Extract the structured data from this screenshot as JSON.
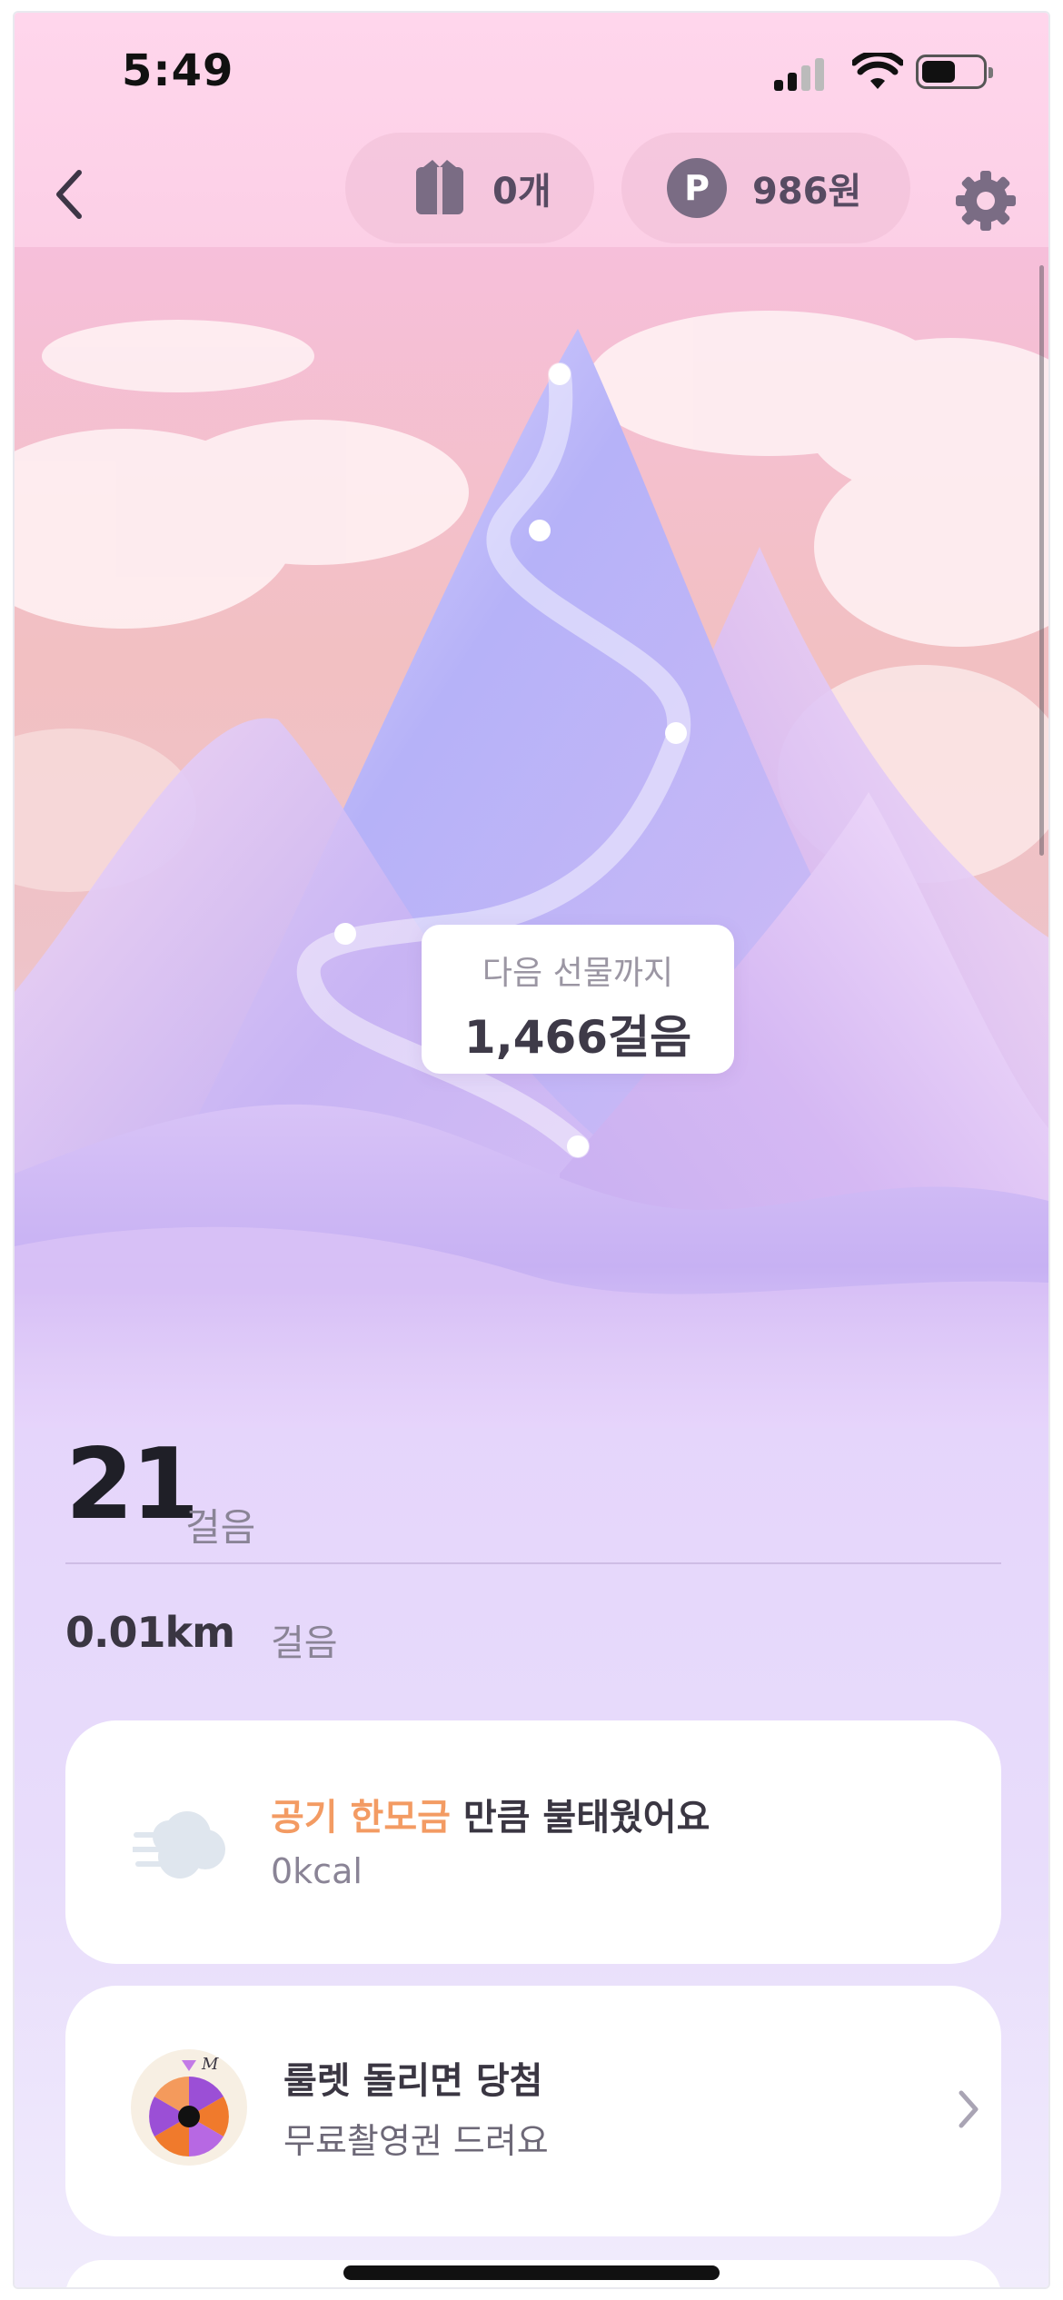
{
  "status_bar": {
    "time": "5:49"
  },
  "header": {
    "gift_count": "0개",
    "points": "986원",
    "point_badge": "P"
  },
  "hero": {
    "tooltip_sub": "다음 선물까지",
    "tooltip_main": "1,466걸음"
  },
  "stats": {
    "steps": "21",
    "steps_unit": "걸음",
    "distance": "0.01km",
    "distance_unit": "걸음"
  },
  "cards": {
    "calorie": {
      "highlight": "공기 한모금",
      "text": " 만큼 불태웠어요",
      "value": "0kcal"
    },
    "roulette": {
      "title": "룰렛 돌리면 당첨",
      "subtitle": "무료촬영권 드려요",
      "wheel_label": "M"
    }
  },
  "colors": {
    "accent_orange": "#f39b63",
    "text_dark": "#3a3642",
    "text_muted": "#8a8496"
  },
  "icons": [
    "back-icon",
    "gift-icon",
    "point-icon",
    "gear-icon",
    "wind-cloud-icon",
    "roulette-wheel-icon",
    "chevron-right-icon"
  ]
}
